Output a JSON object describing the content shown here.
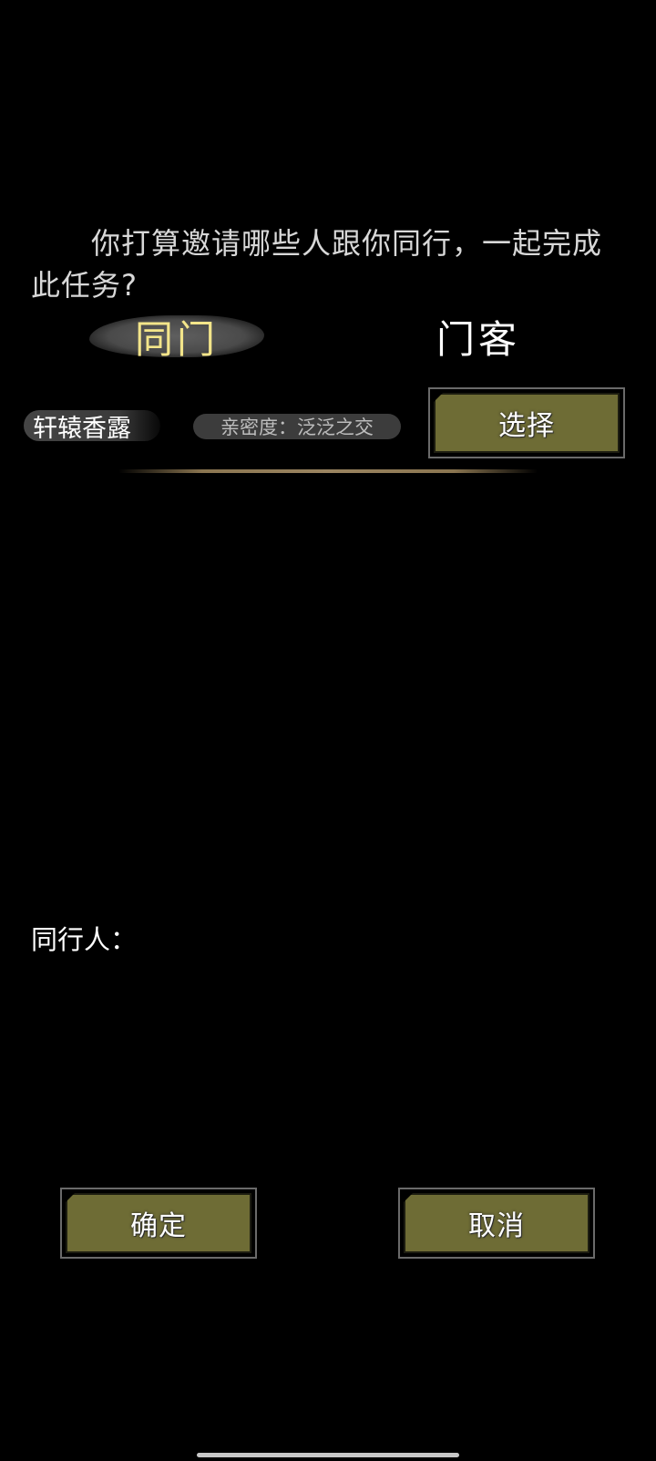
{
  "prompt": {
    "text": "你打算邀请哪些人跟你同行，一起完成此任务?"
  },
  "tabs": [
    {
      "label": "同门",
      "active": true
    },
    {
      "label": "门客",
      "active": false
    }
  ],
  "companion": {
    "name": "轩辕香露",
    "intimacy": "亲密度：泛泛之交",
    "select_label": "选择"
  },
  "companions_label": "同行人：",
  "footer": {
    "confirm_label": "确定",
    "cancel_label": "取消"
  },
  "colors": {
    "background": "#000000",
    "button_fill": "#6e6c35",
    "active_tab_text": "#f3e58a",
    "divider": "#9a8460"
  }
}
